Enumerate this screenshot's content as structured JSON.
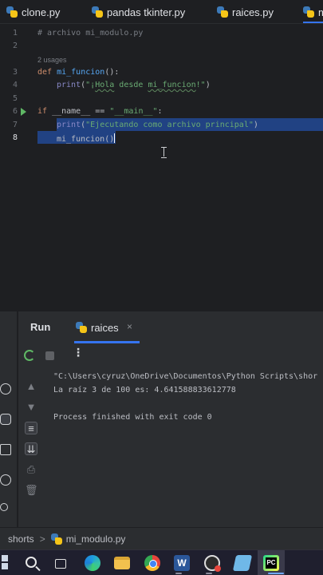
{
  "tabs": [
    {
      "label": "clone.py"
    },
    {
      "label": "pandas tkinter.py"
    },
    {
      "label": "raices.py"
    },
    {
      "label": "m"
    }
  ],
  "editor": {
    "line_numbers": [
      "1",
      "2",
      "3",
      "4",
      "5",
      "6",
      "7",
      "8"
    ],
    "line1_comment": "# archivo mi_modulo.py",
    "usages_hint": "2 usages",
    "line3_def": "def",
    "line3_fn": "mi_funcion",
    "line3_rest": "():",
    "line4_print": "print",
    "line4_open": "(",
    "line4_str_a": "\"¡",
    "line4_str_hola": "Hola",
    "line4_str_b": " desde ",
    "line4_str_fn": "mi_funcion",
    "line4_str_c": "!\"",
    "line4_close": ")",
    "line6_if": "if",
    "line6_name": " __name__ == ",
    "line6_str": "\"__main__\"",
    "line6_colon": ":",
    "line7_print": "print",
    "line7_open": "(",
    "line7_str": "\"Ejecutando como archivo principal\"",
    "line7_close": ")",
    "line8_call": "mi_funcion()"
  },
  "run_panel": {
    "title": "Run",
    "tab_label": "raices",
    "tab_close": "×",
    "more_menu": "⋮",
    "output_lines": [
      "\"C:\\Users\\cyruz\\OneDrive\\Documentos\\Python Scripts\\shor",
      "La raíz 3 de 100 es: 4.641588833612778",
      "",
      "Process finished with exit code 0"
    ]
  },
  "breadcrumb": {
    "folder": "shorts",
    "separator": ">",
    "file": "mi_modulo.py"
  },
  "taskbar": {
    "word_letter": "W",
    "pycharm_label": "PC"
  },
  "colors": {
    "accent": "#3574f0",
    "selection": "#214283",
    "run_green": "#5fb865",
    "keyword": "#cf8e6d",
    "function": "#56a8f5",
    "string": "#6aab73"
  },
  "icons": [
    "python-file-icon",
    "run-gutter-icon",
    "rerun-icon",
    "stop-icon",
    "more-icon",
    "search-icon",
    "windows-start-icon",
    "edge-icon",
    "chrome-icon",
    "word-icon",
    "pycharm-icon"
  ]
}
